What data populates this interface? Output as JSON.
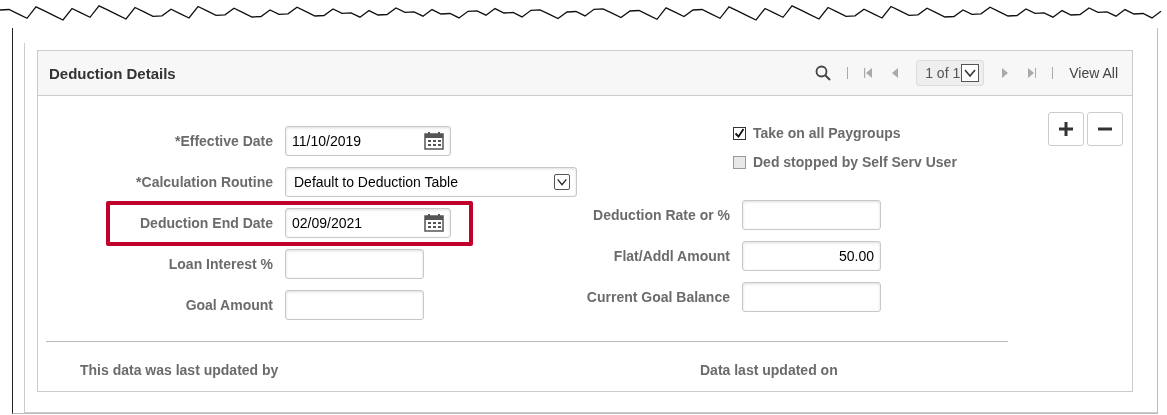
{
  "panel": {
    "title": "Deduction Details",
    "counter": "1 of 1",
    "view_all": "View All"
  },
  "left_fields": [
    {
      "label": "*Effective Date",
      "value": "11/10/2019",
      "kind": "date",
      "highlighted": false
    },
    {
      "label": "*Calculation Routine",
      "value": "Default to Deduction Table",
      "kind": "select",
      "highlighted": false
    },
    {
      "label": "Deduction End Date",
      "value": "02/09/2021",
      "kind": "date",
      "highlighted": true
    },
    {
      "label": "Loan Interest %",
      "kind": "text",
      "highlighted": false
    },
    {
      "label": "Goal Amount",
      "kind": "text",
      "highlighted": false
    }
  ],
  "checkboxes": [
    {
      "label": "Take on all Paygroups",
      "checked": true
    },
    {
      "label": "Ded stopped by Self Serv User",
      "checked": false
    }
  ],
  "right_fields": [
    {
      "label": "Deduction Rate or %",
      "kind": "number"
    },
    {
      "label": "Flat/Addl Amount",
      "value": "50.00",
      "kind": "number"
    },
    {
      "label": "Current Goal Balance",
      "kind": "number"
    }
  ],
  "footer": [
    "This data was last updated by",
    "Data last updated on"
  ]
}
